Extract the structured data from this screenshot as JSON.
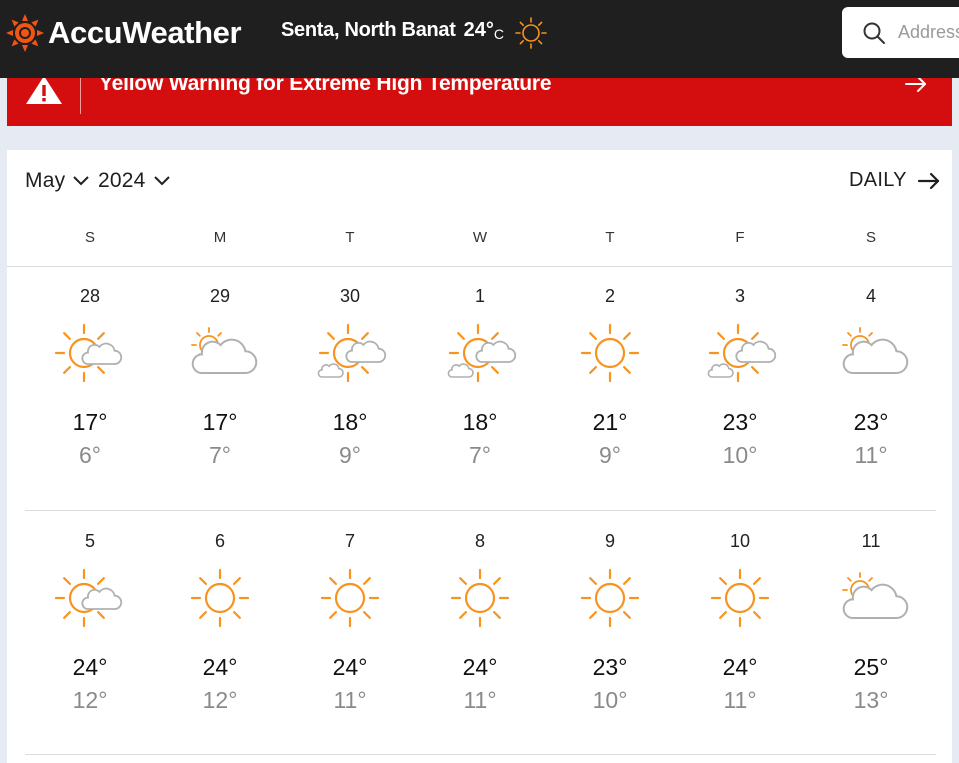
{
  "header": {
    "brand": "AccuWeather",
    "location": "Senta, North Banat",
    "current_temp": "24°",
    "temp_unit": "C",
    "search_placeholder": "Address"
  },
  "alert": {
    "text": "Yellow Warning for Extreme High Temperature"
  },
  "calendar": {
    "month": "May",
    "year": "2024",
    "view_link": "DAILY",
    "weekdays": [
      "S",
      "M",
      "T",
      "W",
      "T",
      "F",
      "S"
    ],
    "weeks": [
      [
        {
          "date": "28",
          "high": "17°",
          "low": "6°",
          "icon": "sun-cloud-small-icon"
        },
        {
          "date": "29",
          "high": "17°",
          "low": "7°",
          "icon": "mostly-cloudy-icon"
        },
        {
          "date": "30",
          "high": "18°",
          "low": "9°",
          "icon": "sun-clouds-icon"
        },
        {
          "date": "1",
          "high": "18°",
          "low": "7°",
          "icon": "sun-clouds-icon"
        },
        {
          "date": "2",
          "high": "21°",
          "low": "9°",
          "icon": "sunny-icon"
        },
        {
          "date": "3",
          "high": "23°",
          "low": "10°",
          "icon": "sun-clouds-icon"
        },
        {
          "date": "4",
          "high": "23°",
          "low": "11°",
          "icon": "mostly-cloudy-icon"
        }
      ],
      [
        {
          "date": "5",
          "high": "24°",
          "low": "12°",
          "icon": "sun-cloud-small-icon"
        },
        {
          "date": "6",
          "high": "24°",
          "low": "12°",
          "icon": "sunny-icon"
        },
        {
          "date": "7",
          "high": "24°",
          "low": "11°",
          "icon": "sunny-icon"
        },
        {
          "date": "8",
          "high": "24°",
          "low": "11°",
          "icon": "sunny-icon"
        },
        {
          "date": "9",
          "high": "23°",
          "low": "10°",
          "icon": "sunny-icon"
        },
        {
          "date": "10",
          "high": "24°",
          "low": "11°",
          "icon": "sunny-icon"
        },
        {
          "date": "11",
          "high": "25°",
          "low": "13°",
          "icon": "mostly-cloudy-icon"
        }
      ]
    ]
  },
  "colors": {
    "header_bg": "#1f1f1f",
    "alert_bg": "#d40e0e",
    "brand_orange": "#f05514",
    "sun_orange": "#f7931e",
    "cloud_gray": "#b0b0b0",
    "low_temp_gray": "#8a8a8a"
  }
}
